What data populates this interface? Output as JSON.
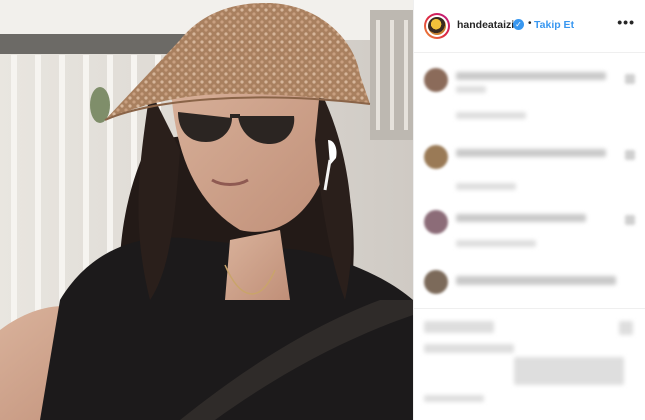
{
  "post": {
    "username": "handeataizi",
    "separator": "•",
    "follow_label": "Takip Et",
    "more_label": "•••",
    "verified_mark": "✓"
  },
  "photo": {
    "subject": "woman-wearing-straw-visor-and-sunglasses"
  },
  "icons": {
    "avatar": "profile-avatar-icon",
    "verified": "verified-badge-icon",
    "more": "more-options-icon"
  },
  "colors": {
    "accent": "#3897f0",
    "text": "#262626",
    "border": "#efefef"
  }
}
